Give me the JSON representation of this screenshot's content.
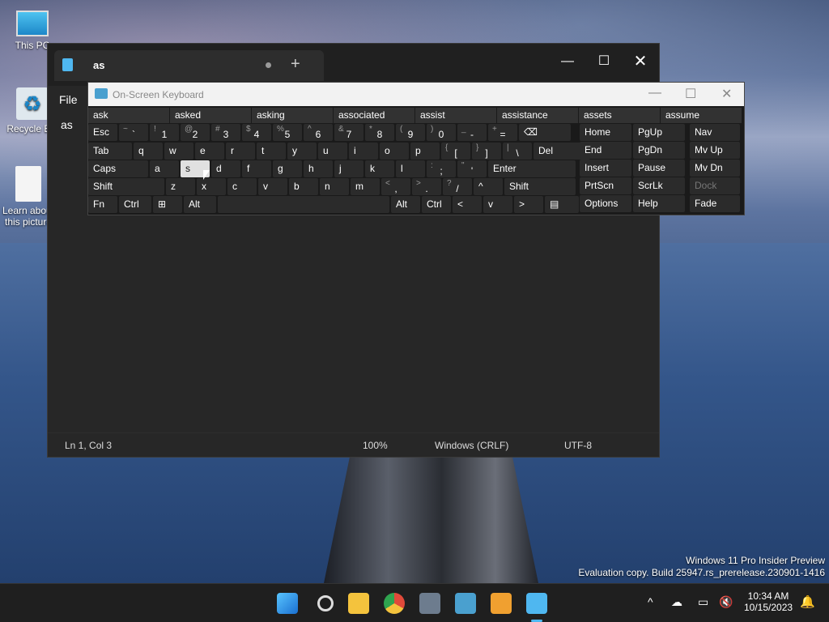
{
  "desktop": {
    "icons": [
      {
        "name": "this-pc",
        "label": "This PC"
      },
      {
        "name": "recycle-bin",
        "label": "Recycle Bin"
      },
      {
        "name": "learn-about",
        "label": "Learn about this picture"
      }
    ],
    "watermark_line1": "Windows 11 Pro Insider Preview",
    "watermark_line2": "Evaluation copy. Build 25947.rs_prerelease.230901-1416"
  },
  "notepad": {
    "tab_title": "as",
    "menu_file": "File",
    "text": "as",
    "status": {
      "position": "Ln 1, Col 3",
      "zoom": "100%",
      "line_ending": "Windows (CRLF)",
      "encoding": "UTF-8"
    }
  },
  "osk": {
    "title": "On-Screen Keyboard",
    "suggestions": [
      "ask",
      "asked",
      "asking",
      "associated",
      "assist",
      "assistance",
      "assets",
      "assume"
    ],
    "row1": [
      {
        "m": "Esc"
      },
      {
        "s": "~",
        "m": "`"
      },
      {
        "s": "!",
        "m": "1"
      },
      {
        "s": "@",
        "m": "2"
      },
      {
        "s": "#",
        "m": "3"
      },
      {
        "s": "$",
        "m": "4"
      },
      {
        "s": "%",
        "m": "5"
      },
      {
        "s": "^",
        "m": "6"
      },
      {
        "s": "&",
        "m": "7"
      },
      {
        "s": "*",
        "m": "8"
      },
      {
        "s": "(",
        "m": "9"
      },
      {
        "s": ")",
        "m": "0"
      },
      {
        "s": "_",
        "m": "-"
      },
      {
        "s": "+",
        "m": "="
      },
      {
        "m": "⌫"
      }
    ],
    "row2": [
      "Tab",
      "q",
      "w",
      "e",
      "r",
      "t",
      "y",
      "u",
      "i",
      "o",
      "p",
      "[",
      "]",
      "\\",
      "Del"
    ],
    "row2_shift": {
      "[": "{",
      "]": "}",
      "\\": "|"
    },
    "row3": [
      "Caps",
      "a",
      "s",
      "d",
      "f",
      "g",
      "h",
      "j",
      "k",
      "l",
      ";",
      "'",
      "Enter"
    ],
    "row3_shift": {
      ";": ":",
      "'": "\""
    },
    "row4": [
      "Shift",
      "z",
      "x",
      "c",
      "v",
      "b",
      "n",
      "m",
      ",",
      ".",
      "/",
      "^",
      "Shift"
    ],
    "row4_shift": {
      ",": "<",
      ".": ">",
      "/": "?"
    },
    "row5": [
      "Fn",
      "Ctrl",
      "⊞",
      "Alt",
      "",
      "Alt",
      "Ctrl",
      "<",
      "v",
      ">",
      "▤"
    ],
    "nav_keys": [
      [
        "Home",
        "PgUp",
        "Nav"
      ],
      [
        "End",
        "PgDn",
        "Mv Up"
      ],
      [
        "Insert",
        "Pause",
        "Mv Dn"
      ],
      [
        "PrtScn",
        "ScrLk",
        "Dock"
      ],
      [
        "Options",
        "Help",
        "Fade"
      ]
    ]
  },
  "taskbar": {
    "apps": [
      "start",
      "search",
      "file-explorer",
      "chrome",
      "settings",
      "keyboard",
      "paint",
      "notepad"
    ],
    "time": "10:34 AM",
    "date": "10/15/2023"
  }
}
